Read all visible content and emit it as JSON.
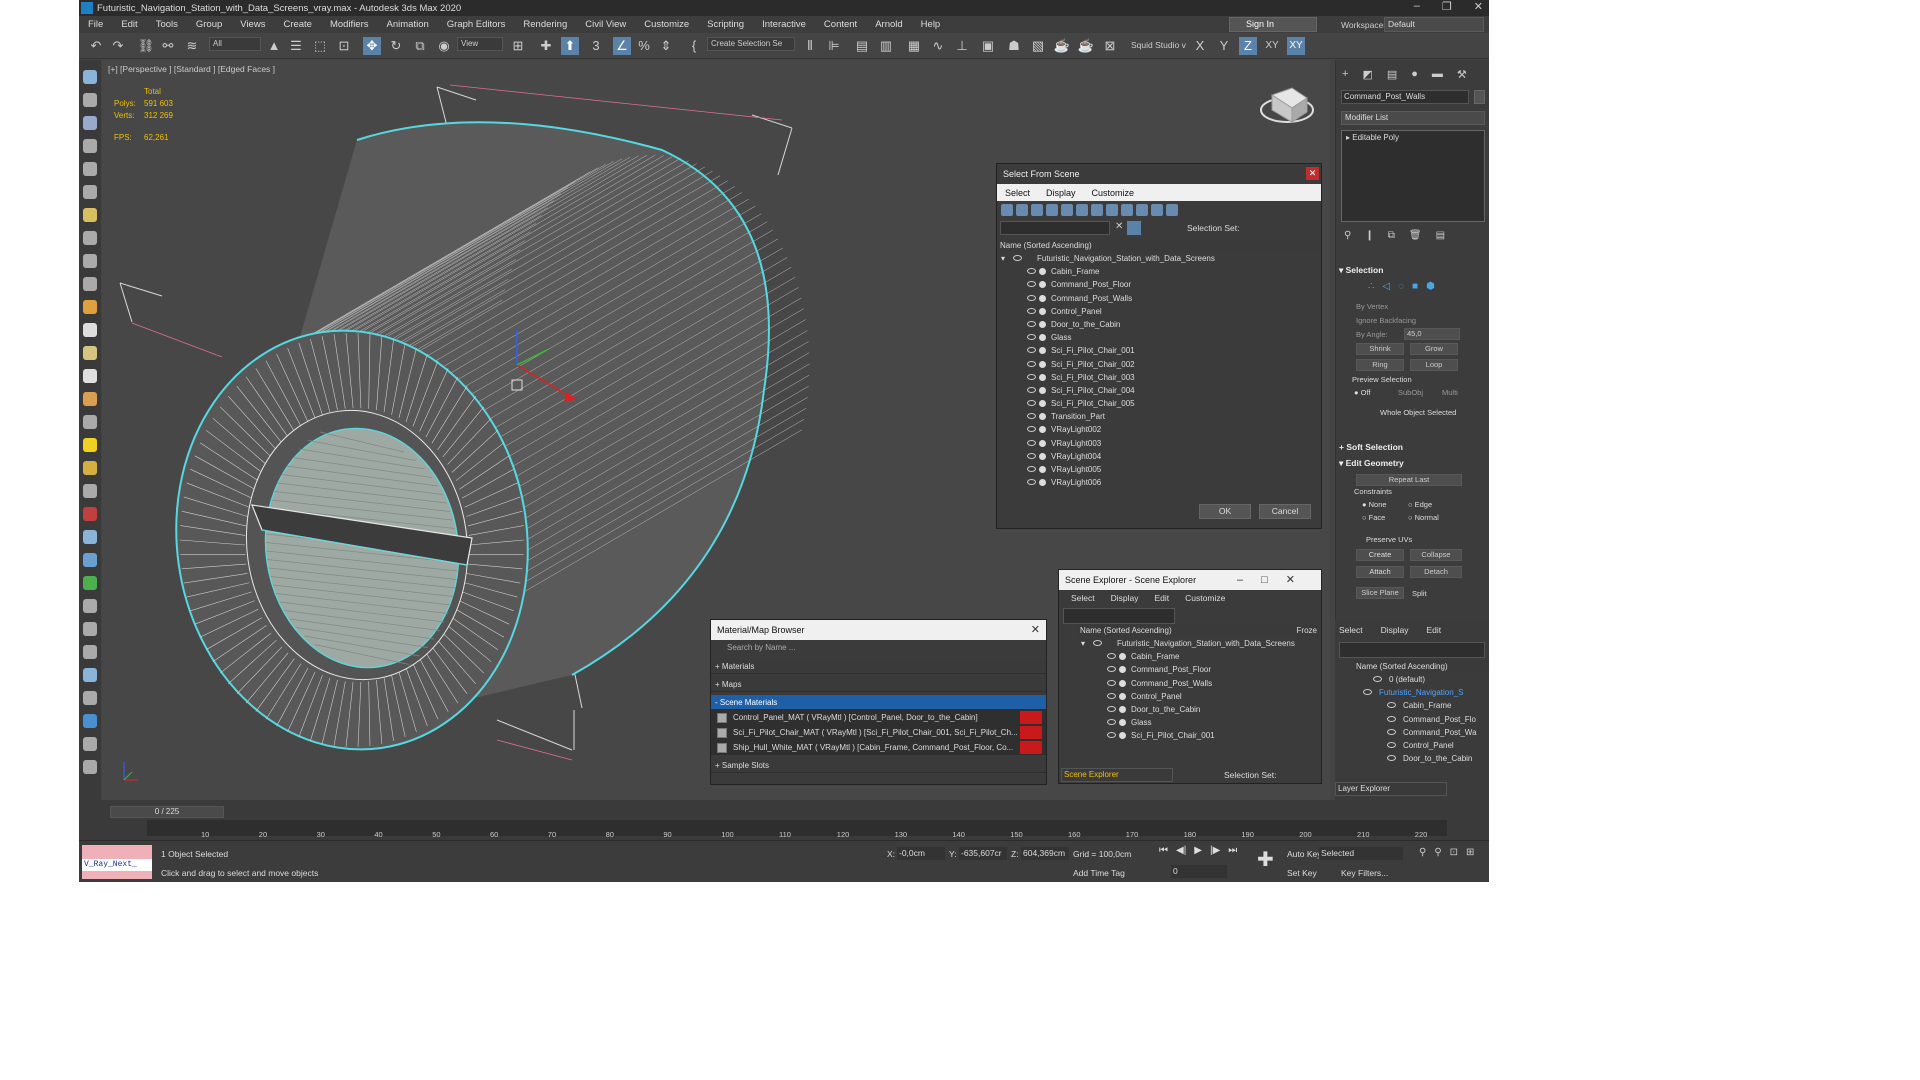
{
  "window": {
    "title": "Futuristic_Navigation_Station_with_Data_Screens_vray.max - Autodesk 3ds Max 2020"
  },
  "menu": [
    "File",
    "Edit",
    "Tools",
    "Group",
    "Views",
    "Create",
    "Modifiers",
    "Animation",
    "Graph Editors",
    "Rendering",
    "Civil View",
    "Customize",
    "Scripting",
    "Interactive",
    "Content",
    "Arnold",
    "Help"
  ],
  "signin": "Sign In",
  "workspaces": {
    "label": "Workspaces:",
    "value": "Default"
  },
  "toolbar": {
    "filter": "All",
    "view": "View",
    "selection_set": "Create Selection Se",
    "studio": "Squid Studio v",
    "axis_x": "X",
    "axis_y": "Y",
    "axis_z": "Z",
    "axis_xy": "XY",
    "axis_xy2": "XY"
  },
  "viewport": {
    "label": "[+] [Perspective ] [Standard ] [Edged Faces ]",
    "stats": {
      "total": "Total",
      "polys_label": "Polys:",
      "polys": "591 603",
      "verts_label": "Verts:",
      "verts": "312 269",
      "fps_label": "FPS:",
      "fps": "62,261"
    }
  },
  "command_panel": {
    "object_name": "Command_Post_Walls",
    "modifier_list": "Modifier List",
    "stack_item": "Editable Poly",
    "selection": "Selection",
    "by_vertex": "By Vertex",
    "ignore_backfacing": "Ignore Backfacing",
    "by_angle": "By Angle:",
    "angle_value": "45,0",
    "shrink": "Shrink",
    "grow": "Grow",
    "ring": "Ring",
    "loop": "Loop",
    "preview_selection": "Preview Selection",
    "off": "Off",
    "subobj": "SubObj",
    "multi": "Multi",
    "whole_object": "Whole Object Selected",
    "soft_selection": "Soft Selection",
    "edit_geometry": "Edit Geometry",
    "repeat_last": "Repeat Last",
    "constraints": "Constraints",
    "none": "None",
    "edge": "Edge",
    "face": "Face",
    "normal": "Normal",
    "preserve_uvs": "Preserve UVs",
    "create": "Create",
    "collapse": "Collapse",
    "attach": "Attach",
    "detach": "Detach",
    "slice_plane": "Slice Plane",
    "split": "Split"
  },
  "select_from_scene": {
    "title": "Select From Scene",
    "menu": [
      "Select",
      "Display",
      "Customize"
    ],
    "selection_set": "Selection Set:",
    "header": "Name (Sorted Ascending)",
    "root": "Futuristic_Navigation_Station_with_Data_Screens",
    "items": [
      "Cabin_Frame",
      "Command_Post_Floor",
      "Command_Post_Walls",
      "Control_Panel",
      "Door_to_the_Cabin",
      "Glass",
      "Sci_Fi_Pilot_Chair_001",
      "Sci_Fi_Pilot_Chair_002",
      "Sci_Fi_Pilot_Chair_003",
      "Sci_Fi_Pilot_Chair_004",
      "Sci_Fi_Pilot_Chair_005",
      "Transition_Part",
      "VRayLight002",
      "VRayLight003",
      "VRayLight004",
      "VRayLight005",
      "VRayLight006"
    ],
    "ok": "OK",
    "cancel": "Cancel"
  },
  "scene_explorer": {
    "title": "Scene Explorer - Scene Explorer",
    "menu": [
      "Select",
      "Display",
      "Edit",
      "Customize"
    ],
    "header": "Name (Sorted Ascending)",
    "froze": "Froze",
    "root": "Futuristic_Navigation_Station_with_Data_Screens",
    "items": [
      "Cabin_Frame",
      "Command_Post_Floor",
      "Command_Post_Walls",
      "Control_Panel",
      "Door_to_the_Cabin",
      "Glass",
      "Sci_Fi_Pilot_Chair_001"
    ],
    "footer": "Scene Explorer",
    "selection_set": "Selection Set:"
  },
  "material_browser": {
    "title": "Material/Map Browser",
    "search": "Search by Name ...",
    "materials": "+ Materials",
    "maps": "+ Maps",
    "scene_materials": "- Scene Materials",
    "rows": [
      "Control_Panel_MAT  ( VRayMtl ) [Control_Panel, Door_to_the_Cabin]",
      "Sci_Fi_Pilot_Chair_MAT  ( VRayMtl ) [Sci_Fi_Pilot_Chair_001, Sci_Fi_Pilot_Ch...",
      "Ship_Hull_White_MAT  ( VRayMtl ) [Cabin_Frame, Command_Post_Floor, Co..."
    ],
    "sample_slots": "+ Sample Slots"
  },
  "layer_explorer": {
    "menu": [
      "Select",
      "Display",
      "Edit"
    ],
    "header": "Name (Sorted Ascending)",
    "items": [
      "0 (default)",
      "Futuristic_Navigation_S",
      "Cabin_Frame",
      "Command_Post_Flo",
      "Command_Post_Wa",
      "Control_Panel",
      "Door_to_the_Cabin"
    ],
    "footer": "Layer Explorer"
  },
  "timeline": {
    "frame": "0 / 225",
    "ticks": [
      "10",
      "20",
      "30",
      "40",
      "50",
      "60",
      "70",
      "80",
      "90",
      "100",
      "110",
      "120",
      "130",
      "140",
      "150",
      "160",
      "170",
      "180",
      "190",
      "200",
      "210",
      "220"
    ]
  },
  "status": {
    "maxscript": "V_Ray_Next_",
    "selected": "1 Object Selected",
    "hint": "Click and drag to select and move objects",
    "x_label": "X:",
    "x": "-0,0cm",
    "y_label": "Y:",
    "y": "-635,607cr",
    "z_label": "Z:",
    "z": "604,369cm",
    "grid": "Grid = 100,0cm",
    "add_time_tag": "Add Time Tag",
    "auto_key": "Auto Key",
    "key_mode": "Selected",
    "set_key": "Set Key",
    "key_filters": "Key Filters...",
    "frame_field": "0"
  }
}
